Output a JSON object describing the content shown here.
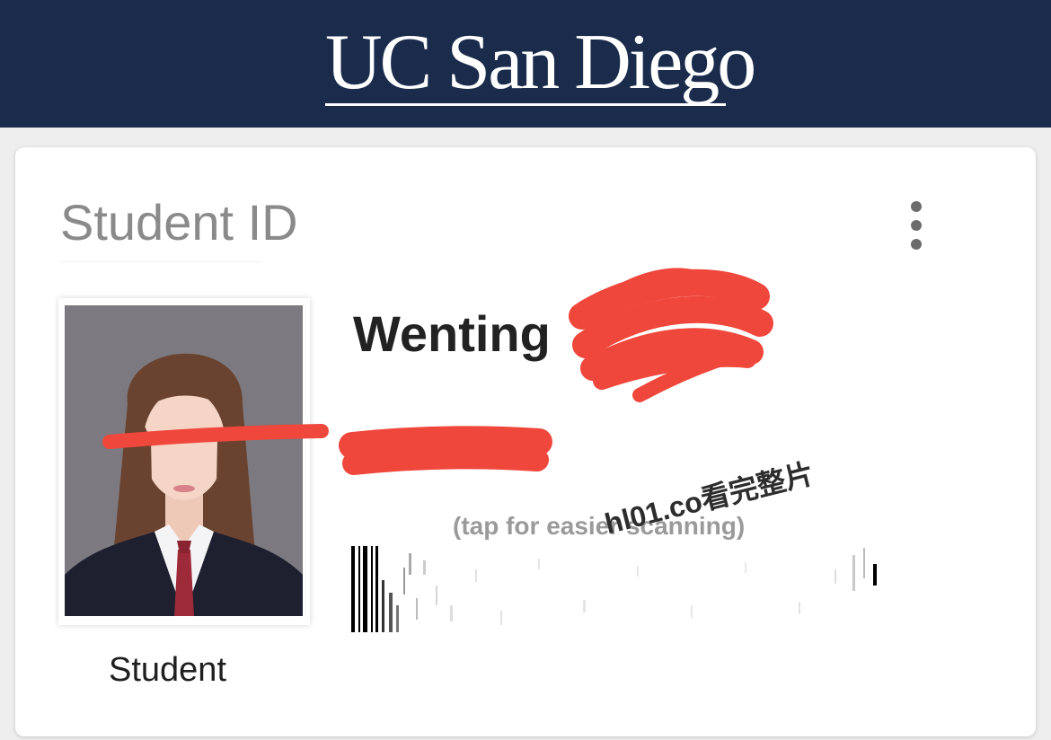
{
  "header": {
    "logo_text": "UC San Diego",
    "background_color": "#1a2b4c"
  },
  "card": {
    "title": "Student ID",
    "menu_icon": "more-vertical-icon",
    "student": {
      "first_name": "Wenting",
      "role": "Student"
    },
    "scan_hint": "(tap for easier scanning)"
  },
  "redaction_color": "#f0473c",
  "watermark": {
    "text": "hl01.co看完整片"
  }
}
